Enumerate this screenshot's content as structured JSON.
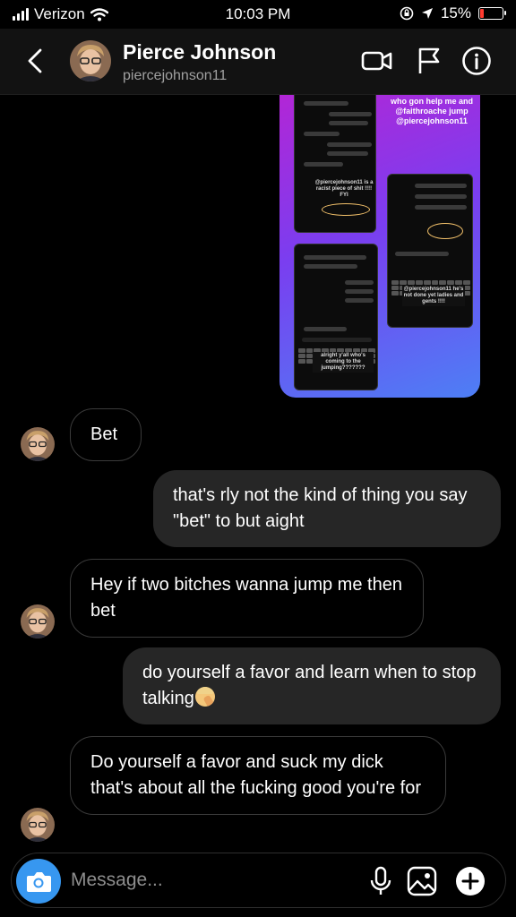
{
  "status_bar": {
    "carrier": "Verizon",
    "time": "10:03 PM",
    "battery": "15%",
    "battery_level": 0.15,
    "battery_color": "#ff3b30"
  },
  "header": {
    "name": "Pierce Johnson",
    "username": "piercejohnson11",
    "icons": [
      "back-chevron-icon",
      "video-call-icon",
      "flag-icon",
      "info-icon"
    ]
  },
  "shared_story": {
    "caption": "who gon help me and @faithroache jump @piercejohnson11",
    "panel_1_text": "@piercejohnson11 is a racist piece of shit !!!! FYI",
    "panel_2_text": "@piercejohnson11 he's not done yet ladies and gents !!!!",
    "panel_3_text": "alright y'all who's coming to the jumping???????"
  },
  "messages": [
    {
      "from": "them",
      "text": "Bet"
    },
    {
      "from": "me",
      "text": "that's rly not the kind of thing you say \"bet\" to but aight"
    },
    {
      "from": "them",
      "text": "Hey if two bitches wanna jump me then bet"
    },
    {
      "from": "me",
      "text": "do yourself a favor and learn when to stop talking",
      "emoji": "person-facepalming-emoji"
    },
    {
      "from": "them",
      "text": "Do yourself a favor and suck my dick that's about all the fucking good you're for"
    }
  ],
  "composer": {
    "placeholder": "Message...",
    "icons": [
      "camera-icon",
      "microphone-icon",
      "gallery-icon",
      "plus-icon"
    ],
    "accent": "#3797f0"
  },
  "colors": {
    "outgoing_bubble": "#262626",
    "incoming_border": "#3a3a3a",
    "background": "#000000"
  }
}
